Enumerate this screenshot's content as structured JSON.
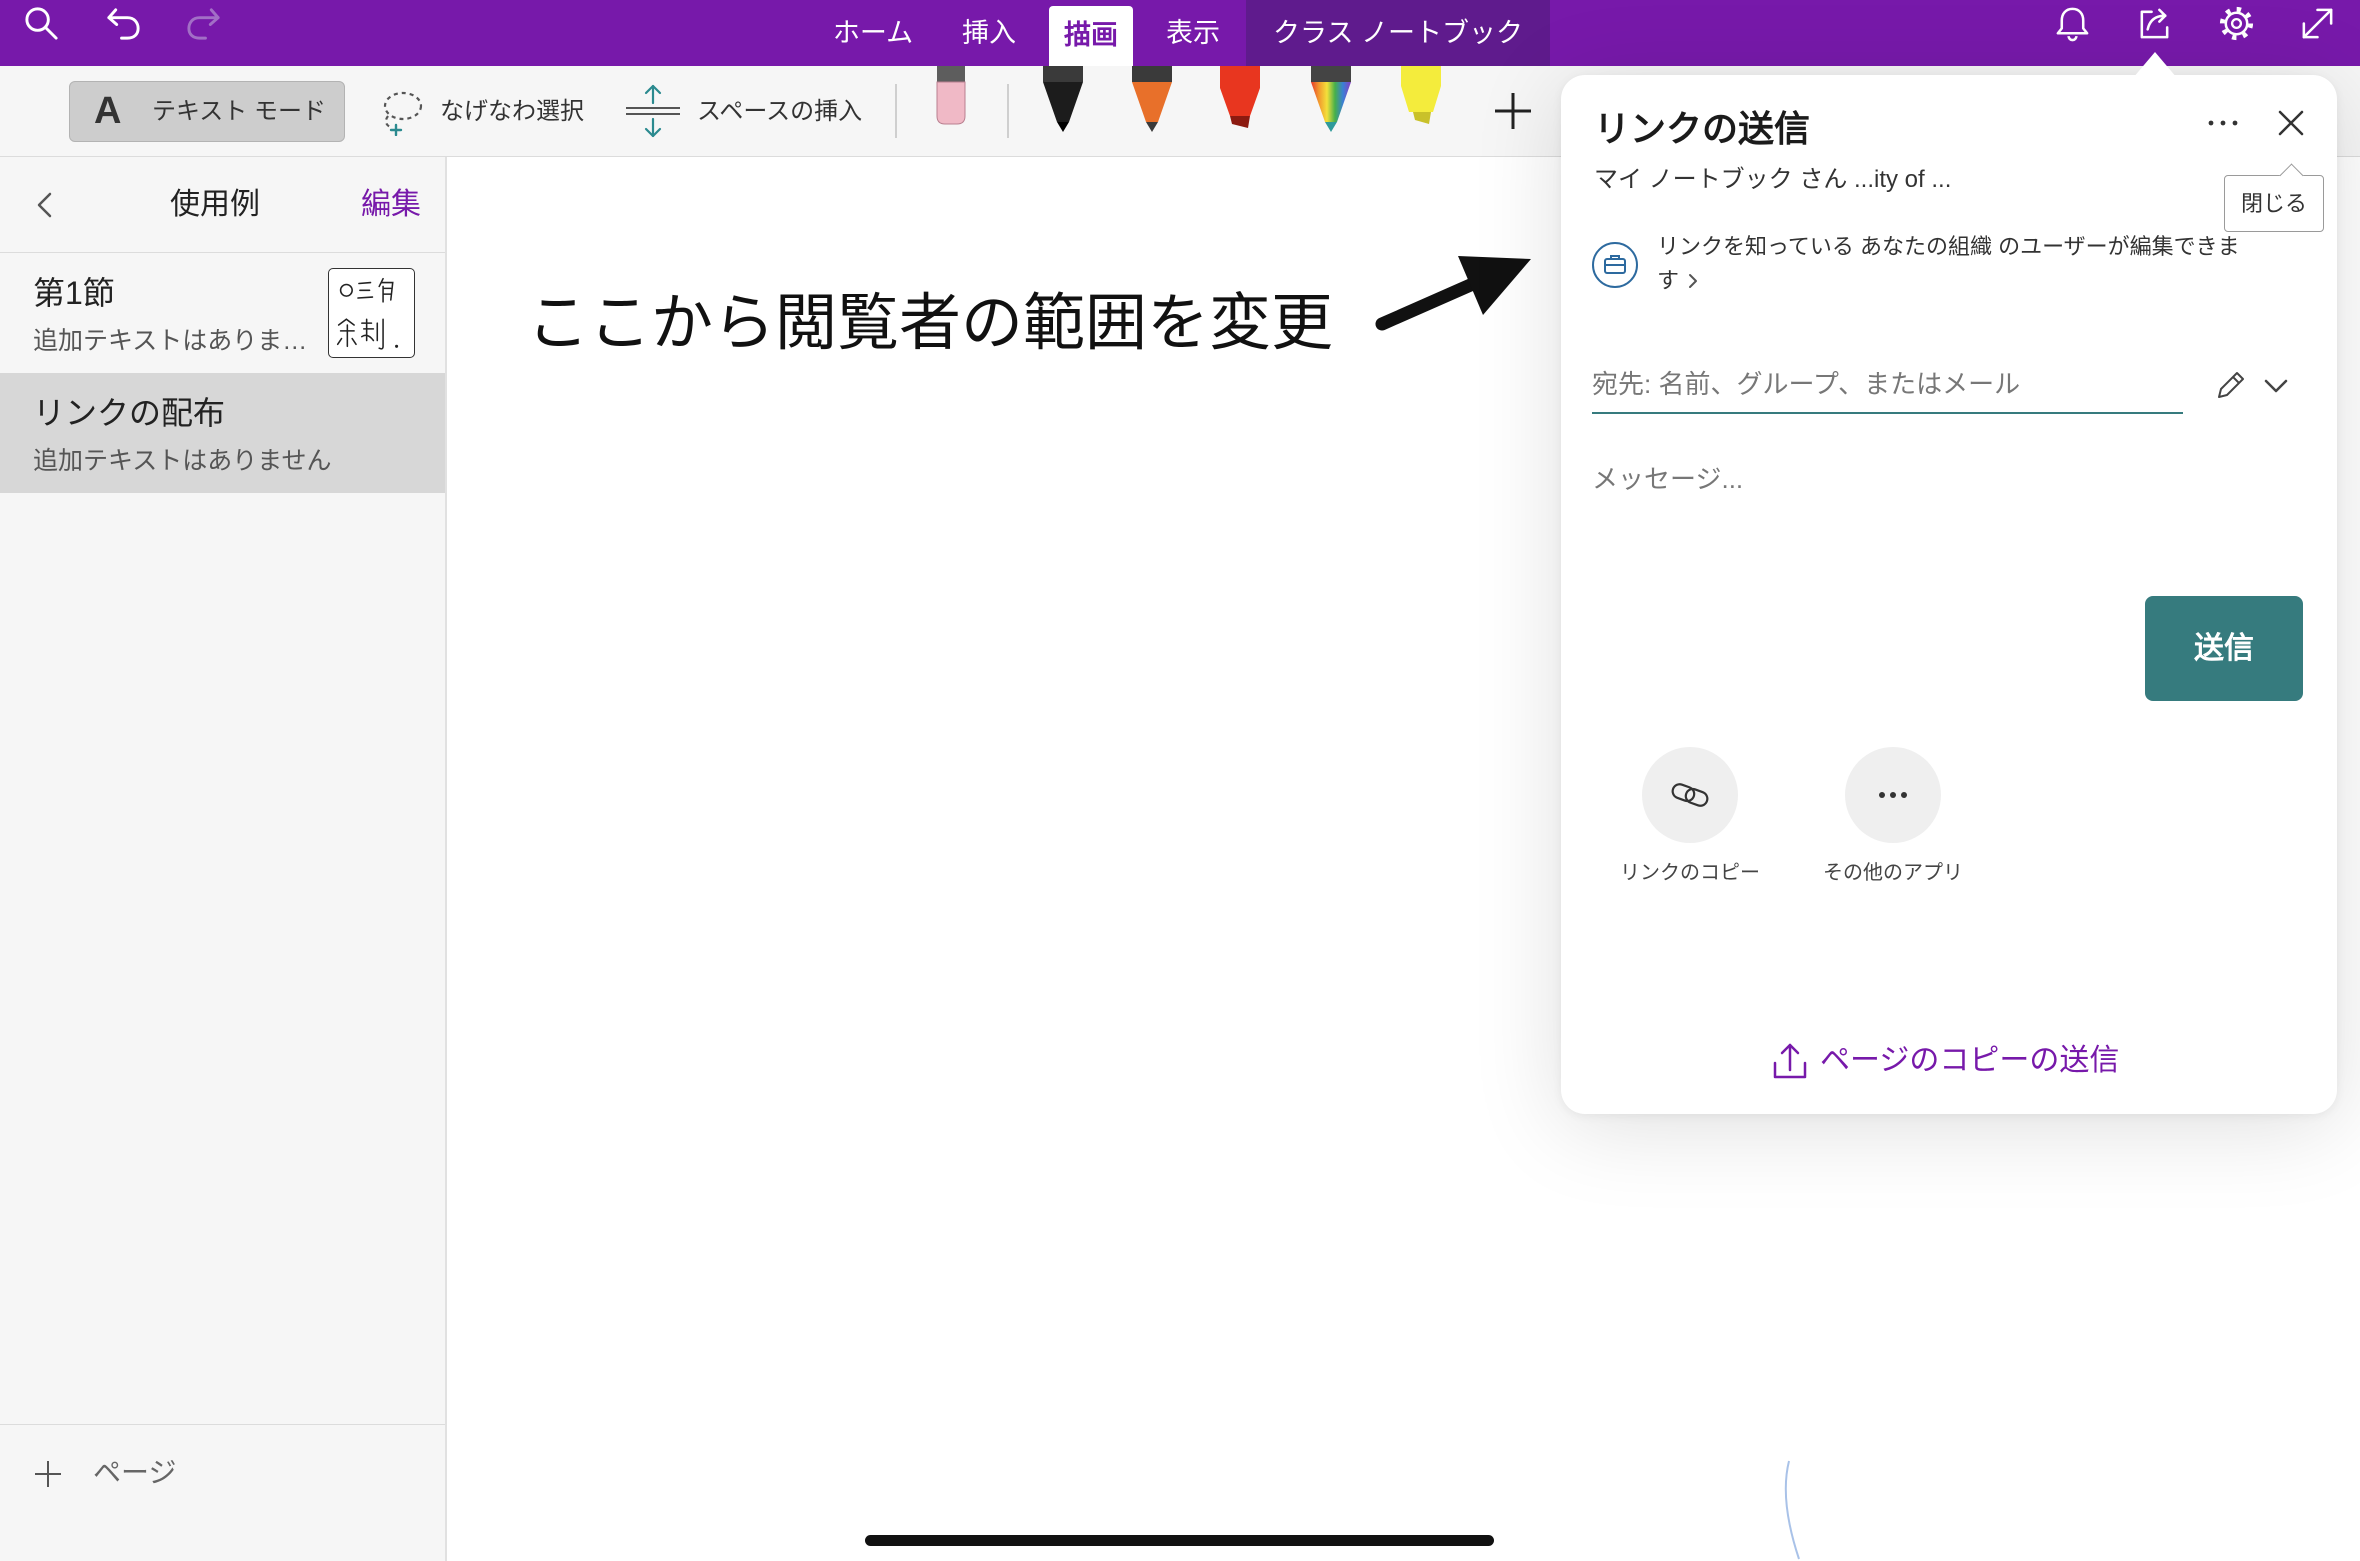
{
  "colors": {
    "accent": "#7719aa",
    "accent_dark": "#5f1b8d",
    "teal": "#367b7e"
  },
  "topbar": {
    "icons_left": [
      "search-icon",
      "undo-icon",
      "redo-icon"
    ],
    "tabs": [
      {
        "label": "ホーム",
        "selected": false
      },
      {
        "label": "挿入",
        "selected": false
      },
      {
        "label": "描画",
        "selected": true
      },
      {
        "label": "表示",
        "selected": false
      },
      {
        "label": "クラス ノートブック",
        "selected": false
      }
    ],
    "icons_right": [
      "bell-icon",
      "share-icon",
      "settings-icon",
      "expand-icon"
    ]
  },
  "toolbar": {
    "text_mode": {
      "glyph": "A",
      "label": "テキスト モード",
      "active": true
    },
    "lasso_label": "なげなわ選択",
    "space_insert_label": "スペースの挿入",
    "eraser_color": "#f0b9c6",
    "pens": [
      {
        "color": "#1c1c1c"
      },
      {
        "color": "#e8702a"
      },
      {
        "color": "#e8361f"
      },
      {
        "color": "rainbow"
      },
      {
        "color": "#f4ec3c"
      }
    ],
    "add_icon": "plus-icon"
  },
  "sidebar": {
    "title": "使用例",
    "edit_label": "編集",
    "pages": [
      {
        "title": "第1節",
        "preview": "追加テキストはありま…",
        "selected": false
      },
      {
        "title": "リンクの配布",
        "preview": "追加テキストはありません",
        "selected": true
      }
    ],
    "add_page_label": "ページ"
  },
  "canvas": {
    "annotation": "ここから閲覧者の範囲を変更"
  },
  "share_panel": {
    "title": "リンクの送信",
    "subtitle": "マイ ノートブック さん ...ity of ...",
    "close_tooltip": "閉じる",
    "permission_text": "リンクを知っている あなたの組織 のユーザーが編集できます",
    "to_placeholder": "宛先: 名前、グループ、またはメール",
    "message_placeholder": "メッセージ...",
    "send_label": "送信",
    "share_targets": [
      {
        "label": "リンクのコピー",
        "icon": "link-icon"
      },
      {
        "label": "その他のアプリ",
        "icon": "more-apps-icon"
      }
    ],
    "send_copy_label": "ページのコピーの送信"
  }
}
